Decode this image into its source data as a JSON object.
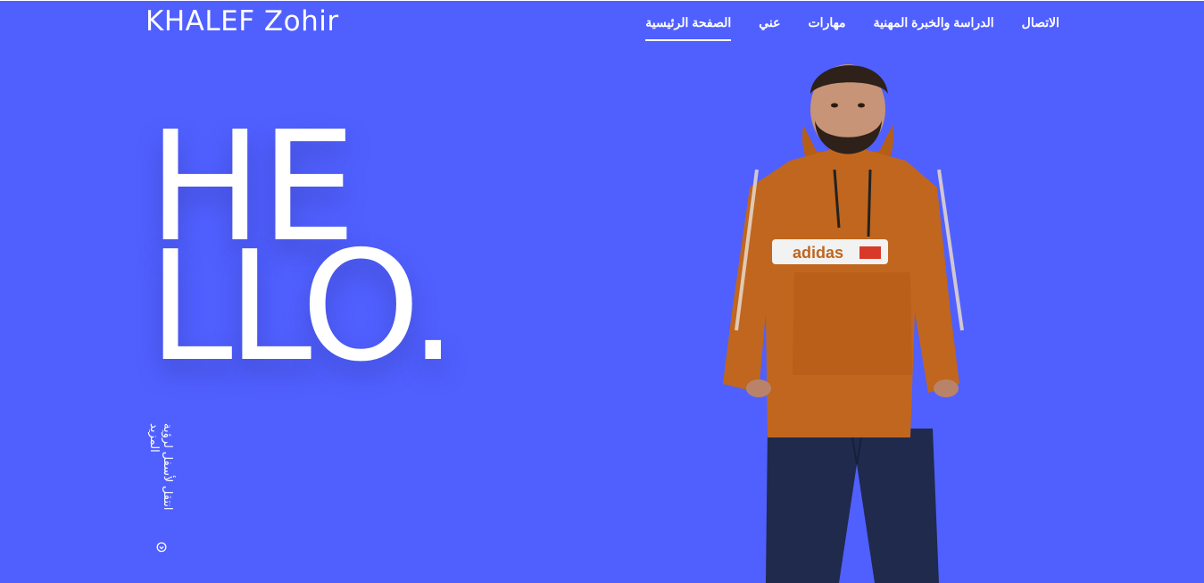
{
  "brand": {
    "name": "KHALEF Zohir"
  },
  "nav": {
    "items": [
      {
        "label": "الصفحة الرئيسية",
        "active": true
      },
      {
        "label": "عني",
        "active": false
      },
      {
        "label": "مهارات",
        "active": false
      },
      {
        "label": "الدراسة والخبرة المهنية",
        "active": false
      },
      {
        "label": "الاتصال",
        "active": false
      }
    ]
  },
  "hero": {
    "line1": "HE",
    "line2": "LLO.",
    "scroll_hint": "انتقل لأسفل لرؤية المزيد",
    "scroll_icon": "circle-arrow-down-icon",
    "photo_logo_text": "adidas"
  },
  "colors": {
    "background": "#5060ff",
    "text": "#ffffff",
    "jacket": "#c0661e"
  }
}
